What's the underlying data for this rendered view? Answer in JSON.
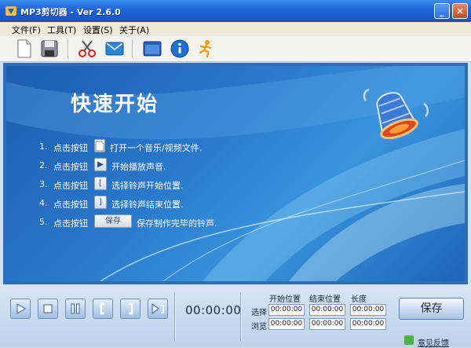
{
  "window": {
    "title": "MP3剪切器 - Ver 2.6.0",
    "minimize": "_",
    "close": "×"
  },
  "menu": [
    "文件(F)",
    "工具(T)",
    "设置(S)",
    "关于(A)"
  ],
  "toolbar": {
    "icons": [
      "new-file-icon",
      "save-icon",
      "cut-icon",
      "mail-icon",
      "window-icon",
      "info-icon",
      "runner-icon"
    ]
  },
  "main": {
    "heading": "快速开始",
    "steps": [
      {
        "num": "1.",
        "pre": "点击按钮",
        "btn": "",
        "post": "打开一个音乐/视频文件."
      },
      {
        "num": "2.",
        "pre": "点击按钮",
        "btn": "▶",
        "post": "开始播放声音."
      },
      {
        "num": "3.",
        "pre": "点击按钮",
        "btn": "[",
        "post": "选择铃声开始位置."
      },
      {
        "num": "4.",
        "pre": "点击按钮",
        "btn": "]",
        "post": "选择铃声结束位置."
      },
      {
        "num": "5.",
        "pre": "点击按钮",
        "btn": "保存",
        "post": "保存制作完毕的铃声."
      }
    ]
  },
  "controls": {
    "time": "00:00:00",
    "headers": {
      "start": "开始位置",
      "end": "结束位置",
      "length": "长度"
    },
    "rows": [
      {
        "label": "选择",
        "start": "00:00:00",
        "end": "00:00:00",
        "length": "00:00:00"
      },
      {
        "label": "浏览",
        "start": "00:00:00",
        "end": "00:00:00",
        "length": "00:00:00"
      }
    ],
    "save": "保存",
    "feedback": "意见反馈"
  },
  "colors": {
    "titlebar": "#1f63d8",
    "panel": "#2a78cc",
    "bottom": "#cfe0f3"
  }
}
